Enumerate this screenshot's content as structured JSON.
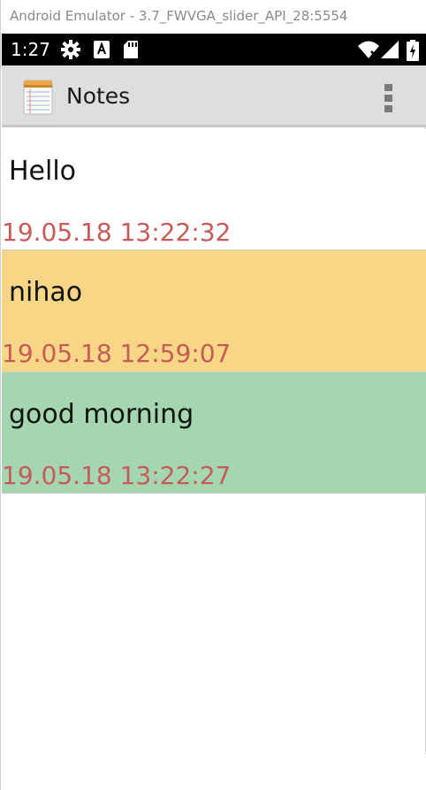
{
  "window": {
    "title": "Android Emulator - 3.7_FWVGA_slider_API_28:5554"
  },
  "status_bar": {
    "time": "1:27",
    "icons": [
      "gear-icon",
      "keyboard-a-icon",
      "sd-card-icon",
      "wifi-icon",
      "signal-icon",
      "battery-icon"
    ]
  },
  "app_bar": {
    "title": "Notes",
    "icon": "notepad-icon",
    "menu_icon": "more-vertical-icon"
  },
  "notes": [
    {
      "title": "Hello",
      "timestamp": "19.05.18 13:22:32",
      "color": "#ffffff"
    },
    {
      "title": "nihao",
      "timestamp": "19.05.18 12:59:07",
      "color": "#f7d786"
    },
    {
      "title": "good morning",
      "timestamp": "19.05.18 13:22:27",
      "color": "#a4d6b0"
    }
  ],
  "colors": {
    "timestamp": "#c85a5a",
    "app_bar": "#dedede",
    "status_bar": "#000000"
  }
}
